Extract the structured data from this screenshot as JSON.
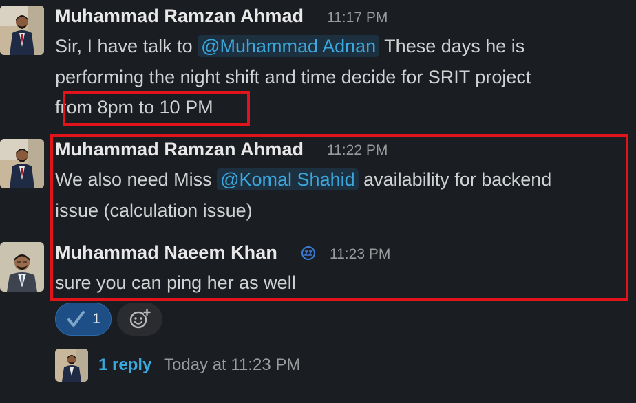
{
  "messages": [
    {
      "author": "Muhammad Ramzan Ahmad",
      "time": "11:17 PM",
      "lines": {
        "l1_pre": "Sir, I have talk to ",
        "l1_mention": "@Muhammad Adnan",
        "l1_post": " These days he is",
        "l2": "performing the night shift and time decide for SRIT project",
        "l3": "from 8pm to 10 PM"
      }
    },
    {
      "author": "Muhammad Ramzan Ahmad",
      "time": "11:22 PM",
      "lines": {
        "l1_pre": "We also need Miss ",
        "l1_mention": "@Komal Shahid",
        "l1_post": " availability for backend",
        "l2": "issue (calculation issue)"
      }
    },
    {
      "author": "Muhammad Naeem Khan",
      "time": "11:23 PM",
      "lines": {
        "l1": "sure you can ping her as well"
      }
    }
  ],
  "reaction": {
    "emoji": "check-mark",
    "count": "1"
  },
  "thread": {
    "reply_label": "1 reply",
    "reply_time": "Today at 11:23 PM"
  },
  "colors": {
    "background": "#1a1d21",
    "mention_text": "#3ba7dc",
    "mention_bg": "#1d3040",
    "highlight_box": "#e0141a",
    "reaction_bg": "#1d4e85"
  }
}
